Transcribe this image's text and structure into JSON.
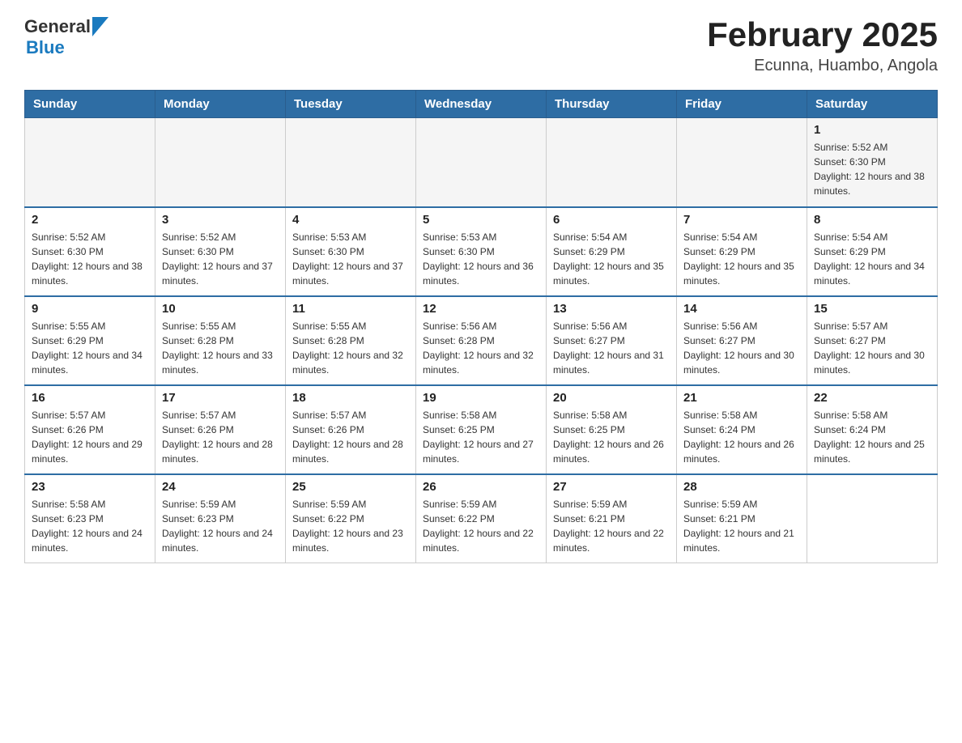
{
  "header": {
    "logo": {
      "general": "General",
      "arrow": "▶",
      "blue": "Blue"
    },
    "title": "February 2025",
    "subtitle": "Ecunna, Huambo, Angola"
  },
  "weekdays": [
    "Sunday",
    "Monday",
    "Tuesday",
    "Wednesday",
    "Thursday",
    "Friday",
    "Saturday"
  ],
  "weeks": [
    [
      {
        "day": "",
        "sunrise": "",
        "sunset": "",
        "daylight": ""
      },
      {
        "day": "",
        "sunrise": "",
        "sunset": "",
        "daylight": ""
      },
      {
        "day": "",
        "sunrise": "",
        "sunset": "",
        "daylight": ""
      },
      {
        "day": "",
        "sunrise": "",
        "sunset": "",
        "daylight": ""
      },
      {
        "day": "",
        "sunrise": "",
        "sunset": "",
        "daylight": ""
      },
      {
        "day": "",
        "sunrise": "",
        "sunset": "",
        "daylight": ""
      },
      {
        "day": "1",
        "sunrise": "Sunrise: 5:52 AM",
        "sunset": "Sunset: 6:30 PM",
        "daylight": "Daylight: 12 hours and 38 minutes."
      }
    ],
    [
      {
        "day": "2",
        "sunrise": "Sunrise: 5:52 AM",
        "sunset": "Sunset: 6:30 PM",
        "daylight": "Daylight: 12 hours and 38 minutes."
      },
      {
        "day": "3",
        "sunrise": "Sunrise: 5:52 AM",
        "sunset": "Sunset: 6:30 PM",
        "daylight": "Daylight: 12 hours and 37 minutes."
      },
      {
        "day": "4",
        "sunrise": "Sunrise: 5:53 AM",
        "sunset": "Sunset: 6:30 PM",
        "daylight": "Daylight: 12 hours and 37 minutes."
      },
      {
        "day": "5",
        "sunrise": "Sunrise: 5:53 AM",
        "sunset": "Sunset: 6:30 PM",
        "daylight": "Daylight: 12 hours and 36 minutes."
      },
      {
        "day": "6",
        "sunrise": "Sunrise: 5:54 AM",
        "sunset": "Sunset: 6:29 PM",
        "daylight": "Daylight: 12 hours and 35 minutes."
      },
      {
        "day": "7",
        "sunrise": "Sunrise: 5:54 AM",
        "sunset": "Sunset: 6:29 PM",
        "daylight": "Daylight: 12 hours and 35 minutes."
      },
      {
        "day": "8",
        "sunrise": "Sunrise: 5:54 AM",
        "sunset": "Sunset: 6:29 PM",
        "daylight": "Daylight: 12 hours and 34 minutes."
      }
    ],
    [
      {
        "day": "9",
        "sunrise": "Sunrise: 5:55 AM",
        "sunset": "Sunset: 6:29 PM",
        "daylight": "Daylight: 12 hours and 34 minutes."
      },
      {
        "day": "10",
        "sunrise": "Sunrise: 5:55 AM",
        "sunset": "Sunset: 6:28 PM",
        "daylight": "Daylight: 12 hours and 33 minutes."
      },
      {
        "day": "11",
        "sunrise": "Sunrise: 5:55 AM",
        "sunset": "Sunset: 6:28 PM",
        "daylight": "Daylight: 12 hours and 32 minutes."
      },
      {
        "day": "12",
        "sunrise": "Sunrise: 5:56 AM",
        "sunset": "Sunset: 6:28 PM",
        "daylight": "Daylight: 12 hours and 32 minutes."
      },
      {
        "day": "13",
        "sunrise": "Sunrise: 5:56 AM",
        "sunset": "Sunset: 6:27 PM",
        "daylight": "Daylight: 12 hours and 31 minutes."
      },
      {
        "day": "14",
        "sunrise": "Sunrise: 5:56 AM",
        "sunset": "Sunset: 6:27 PM",
        "daylight": "Daylight: 12 hours and 30 minutes."
      },
      {
        "day": "15",
        "sunrise": "Sunrise: 5:57 AM",
        "sunset": "Sunset: 6:27 PM",
        "daylight": "Daylight: 12 hours and 30 minutes."
      }
    ],
    [
      {
        "day": "16",
        "sunrise": "Sunrise: 5:57 AM",
        "sunset": "Sunset: 6:26 PM",
        "daylight": "Daylight: 12 hours and 29 minutes."
      },
      {
        "day": "17",
        "sunrise": "Sunrise: 5:57 AM",
        "sunset": "Sunset: 6:26 PM",
        "daylight": "Daylight: 12 hours and 28 minutes."
      },
      {
        "day": "18",
        "sunrise": "Sunrise: 5:57 AM",
        "sunset": "Sunset: 6:26 PM",
        "daylight": "Daylight: 12 hours and 28 minutes."
      },
      {
        "day": "19",
        "sunrise": "Sunrise: 5:58 AM",
        "sunset": "Sunset: 6:25 PM",
        "daylight": "Daylight: 12 hours and 27 minutes."
      },
      {
        "day": "20",
        "sunrise": "Sunrise: 5:58 AM",
        "sunset": "Sunset: 6:25 PM",
        "daylight": "Daylight: 12 hours and 26 minutes."
      },
      {
        "day": "21",
        "sunrise": "Sunrise: 5:58 AM",
        "sunset": "Sunset: 6:24 PM",
        "daylight": "Daylight: 12 hours and 26 minutes."
      },
      {
        "day": "22",
        "sunrise": "Sunrise: 5:58 AM",
        "sunset": "Sunset: 6:24 PM",
        "daylight": "Daylight: 12 hours and 25 minutes."
      }
    ],
    [
      {
        "day": "23",
        "sunrise": "Sunrise: 5:58 AM",
        "sunset": "Sunset: 6:23 PM",
        "daylight": "Daylight: 12 hours and 24 minutes."
      },
      {
        "day": "24",
        "sunrise": "Sunrise: 5:59 AM",
        "sunset": "Sunset: 6:23 PM",
        "daylight": "Daylight: 12 hours and 24 minutes."
      },
      {
        "day": "25",
        "sunrise": "Sunrise: 5:59 AM",
        "sunset": "Sunset: 6:22 PM",
        "daylight": "Daylight: 12 hours and 23 minutes."
      },
      {
        "day": "26",
        "sunrise": "Sunrise: 5:59 AM",
        "sunset": "Sunset: 6:22 PM",
        "daylight": "Daylight: 12 hours and 22 minutes."
      },
      {
        "day": "27",
        "sunrise": "Sunrise: 5:59 AM",
        "sunset": "Sunset: 6:21 PM",
        "daylight": "Daylight: 12 hours and 22 minutes."
      },
      {
        "day": "28",
        "sunrise": "Sunrise: 5:59 AM",
        "sunset": "Sunset: 6:21 PM",
        "daylight": "Daylight: 12 hours and 21 minutes."
      },
      {
        "day": "",
        "sunrise": "",
        "sunset": "",
        "daylight": ""
      }
    ]
  ]
}
